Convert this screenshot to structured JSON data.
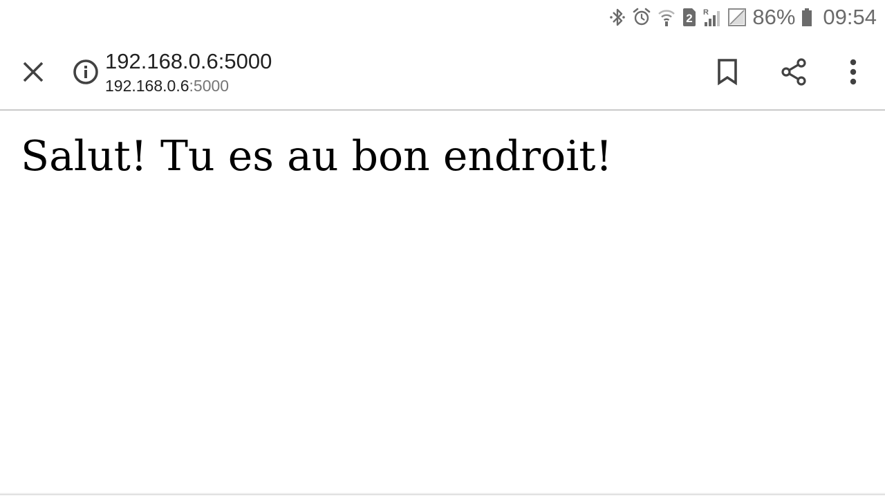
{
  "status_bar": {
    "icons": [
      "bluetooth-icon",
      "alarm-icon",
      "wifi-icon",
      "sim-2-icon",
      "roaming-signal-icon",
      "no-signal-icon",
      "battery-icon"
    ],
    "sim_badge": "2",
    "roaming_label": "R",
    "battery_percent": "86%",
    "time": "09:54",
    "icon_color": "#6b6b6b"
  },
  "toolbar": {
    "close_icon": "close-icon",
    "info_icon": "info-icon",
    "title": "192.168.0.6:5000",
    "url_host": "192.168.0.6",
    "url_port": ":5000",
    "bookmark_icon": "bookmark-icon",
    "share_icon": "share-icon",
    "menu_icon": "more-vert-icon",
    "icon_color": "#424242"
  },
  "page": {
    "heading": "Salut! Tu es au bon endroit!"
  }
}
